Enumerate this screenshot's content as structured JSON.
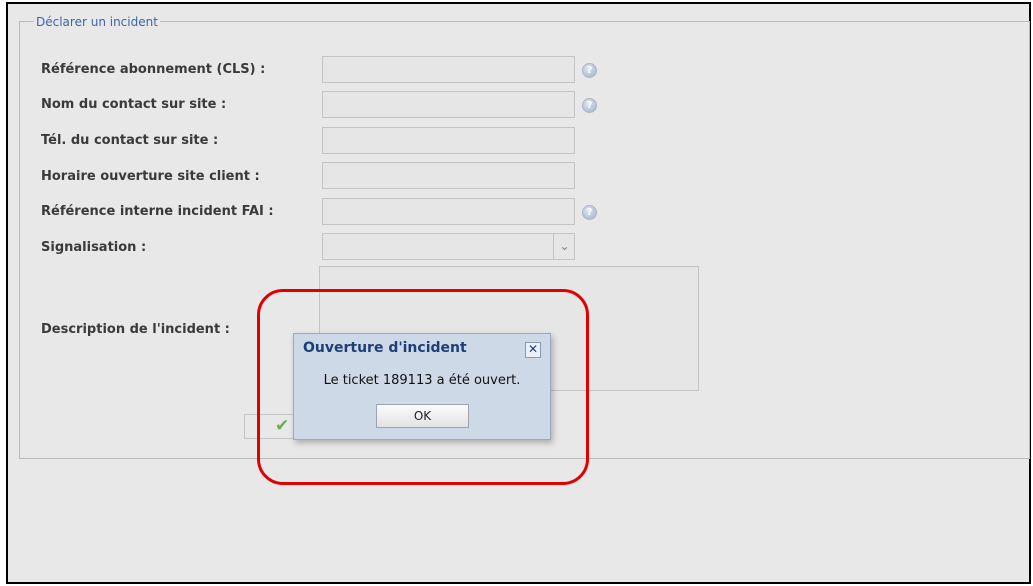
{
  "form": {
    "legend": "Déclarer un incident",
    "fields": [
      {
        "label": "Référence abonnement (CLS) :",
        "value": "",
        "help": true
      },
      {
        "label": "Nom du contact sur site :",
        "value": "",
        "help": true
      },
      {
        "label": "Tél. du contact sur site :",
        "value": "",
        "help": false
      },
      {
        "label": "Horaire ouverture site client :",
        "value": "",
        "help": false
      },
      {
        "label": "Référence interne incident FAI :",
        "value": "",
        "help": true
      },
      {
        "label": "Signalisation :",
        "value": "",
        "help": false
      }
    ],
    "description_label": "Description de l'incident :",
    "help_glyph": "?"
  },
  "dialog": {
    "title": "Ouverture d'incident",
    "close_glyph": "✕",
    "message": "Le ticket 189113 a été ouvert.",
    "ok_label": "OK"
  },
  "colors": {
    "highlight": "#e00000",
    "dialog_bg": "#ced9e7",
    "legend_text": "#3f64a8"
  }
}
